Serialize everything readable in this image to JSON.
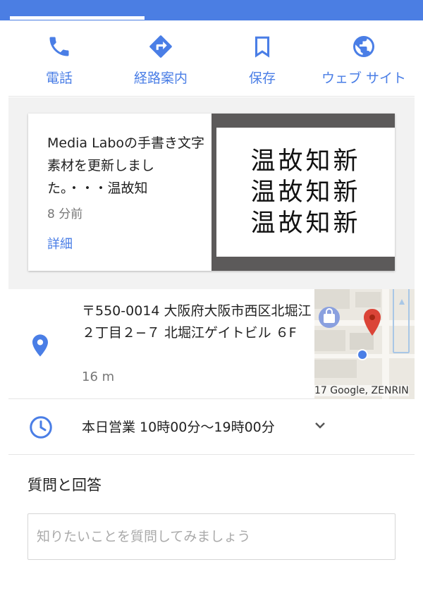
{
  "actions": [
    {
      "label": "電話",
      "icon": "phone-icon"
    },
    {
      "label": "経路案内",
      "icon": "directions-icon"
    },
    {
      "label": "保存",
      "icon": "bookmark-icon"
    },
    {
      "label": "ウェブ サイト",
      "icon": "globe-icon"
    }
  ],
  "post": {
    "body": "Media Laboの手書き文字素材を更新しました。・・・温故知",
    "time": "8 分前",
    "more": "詳細",
    "image_lines": [
      "温故知新",
      "温故知新",
      "温故知新"
    ]
  },
  "address": {
    "text": "〒550-0014 大阪府大阪市西区北堀江２丁目２−７ 北堀江ゲイトビル ６F",
    "distance": "16 m",
    "map_credit": "17 Google, ZENRIN"
  },
  "hours": {
    "text": "本日営業 10時00分～19時00分"
  },
  "qa": {
    "title": "質問と回答",
    "placeholder": "知りたいことを質問してみましょう"
  },
  "colors": {
    "accent": "#4a7ee6",
    "topbar": "#4b7ee3",
    "pin_red": "#db4437"
  }
}
